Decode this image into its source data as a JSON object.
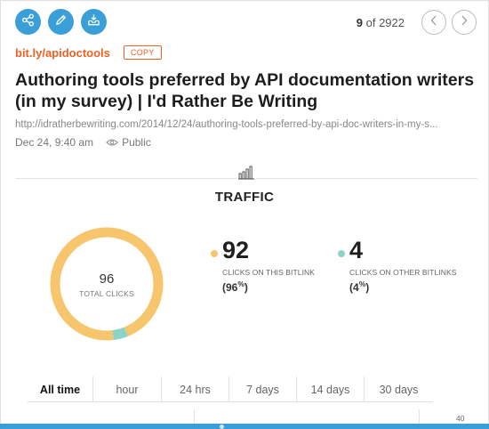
{
  "toolbar": {
    "share_icon": "share-icon",
    "edit_icon": "pencil-icon",
    "archive_icon": "inbox-download-icon",
    "accent_color": "#3a9fd8"
  },
  "pager": {
    "current": "9",
    "of_label": "of",
    "total": "2922"
  },
  "link": {
    "short_url": "bit.ly/apidoctools",
    "copy_label": "COPY",
    "brand_color": "#ee6123"
  },
  "title": "Authoring tools preferred by API documentation writers (in my survey) | I'd Rather Be Writing",
  "long_url": "http://idratherbewriting.com/2014/12/24/authoring-tools-preferred-by-api-doc-writers-in-my-s...",
  "meta": {
    "date": "Dec 24, 9:40 am",
    "visibility": "Public"
  },
  "traffic": {
    "heading": "TRAFFIC",
    "total_clicks": "96",
    "total_label": "TOTAL CLICKS",
    "this_link": {
      "value": "92",
      "label": "CLICKS ON THIS BITLINK",
      "percent": "96",
      "color": "#f7c56b"
    },
    "other_links": {
      "value": "4",
      "label": "CLICKS ON OTHER BITLINKS",
      "percent": "4",
      "color": "#8fd3c7"
    }
  },
  "tabs": [
    {
      "label": "All time",
      "active": true
    },
    {
      "label": "hour",
      "active": false
    },
    {
      "label": "24 hrs",
      "active": false
    },
    {
      "label": "7 days",
      "active": false
    },
    {
      "label": "14 days",
      "active": false
    },
    {
      "label": "30 days",
      "active": false
    }
  ],
  "chart_axis_tick": "40"
}
